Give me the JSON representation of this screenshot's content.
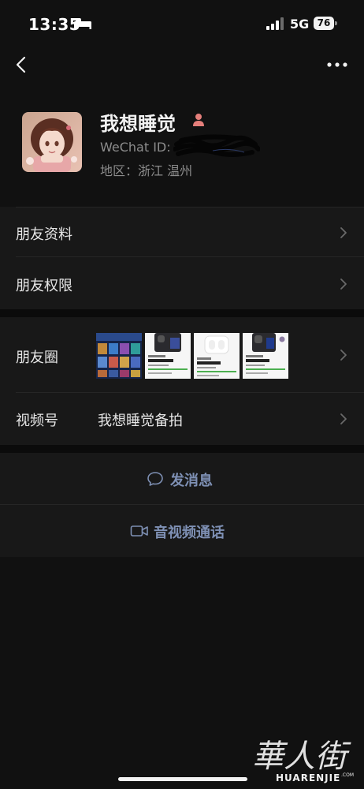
{
  "status_bar": {
    "time": "13:35",
    "network": "5G",
    "battery": "76"
  },
  "profile": {
    "nickname": "我想睡觉",
    "wechat_id_label": "WeChat ID:",
    "region": "地区：浙江 温州"
  },
  "rows": {
    "friend_profile": "朋友资料",
    "friend_permissions": "朋友权限",
    "moments": "朋友圈",
    "channels": "视频号",
    "channel_name": "我想睡觉备拍"
  },
  "actions": {
    "send_message": "发消息",
    "video_call": "音视频通话"
  },
  "colors": {
    "accent": "#7e90b4",
    "background": "#111111",
    "row_background": "#181818"
  },
  "watermark": {
    "logo_chars": "華人街",
    "text": "HUARENJIE",
    "sub": ".COM"
  }
}
